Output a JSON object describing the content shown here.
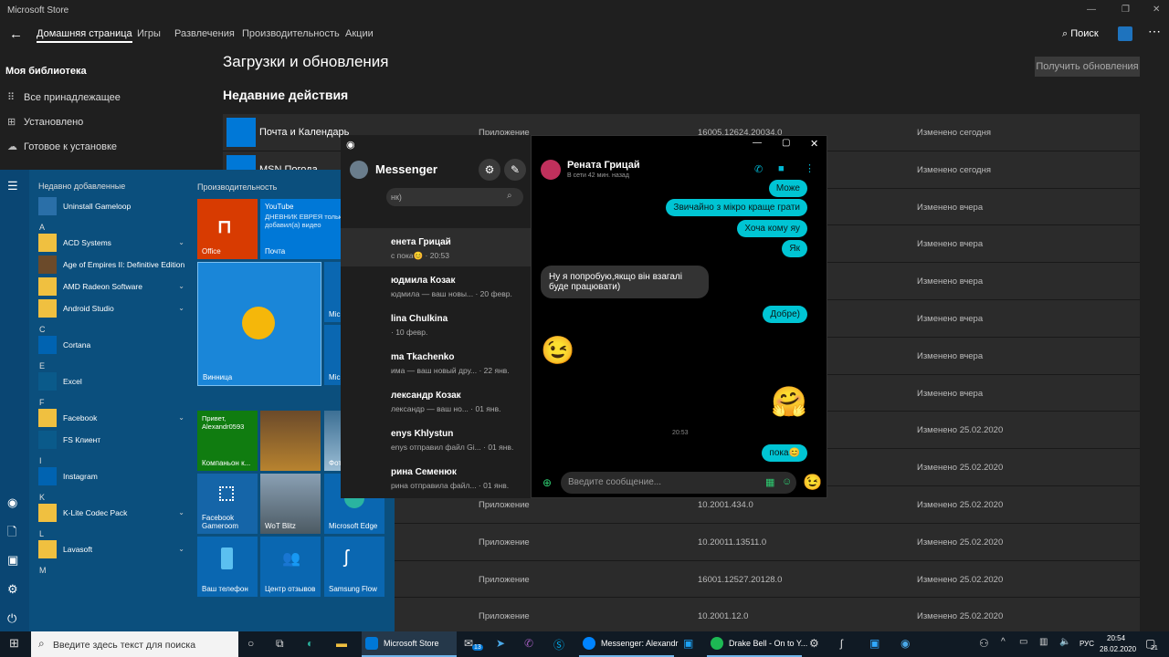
{
  "store": {
    "title": "Microsoft Store",
    "nav": {
      "tabs": [
        "Домашняя страница",
        "Игры",
        "Развлечения",
        "Производительность",
        "Акции"
      ],
      "search_label": "Поиск"
    },
    "library": {
      "heading": "Моя библиотека",
      "items": [
        {
          "icon": "grid-icon",
          "glyph": "⠿",
          "label": "Все принадлежащее"
        },
        {
          "icon": "installed-icon",
          "glyph": "⊞",
          "label": "Установлено"
        },
        {
          "icon": "cloud-icon",
          "glyph": "☁",
          "label": "Готовое к установке"
        }
      ]
    },
    "page_title": "Загрузки и обновления",
    "get_updates_button": "Получить обновления",
    "recent_heading": "Недавние действия",
    "rows": [
      {
        "name": "Почта и Календарь",
        "type": "Приложение",
        "version": "16005.12624.20034.0",
        "status": "Изменено сегодня"
      },
      {
        "name": "MSN Погода",
        "type": "",
        "version": "",
        "status": "Изменено сегодня"
      },
      {
        "name": "",
        "type": "",
        "version": "",
        "status": "Изменено вчера"
      },
      {
        "name": "",
        "type": "",
        "version": "",
        "status": "Изменено вчера"
      },
      {
        "name": "",
        "type": "",
        "version": "",
        "status": "Изменено вчера"
      },
      {
        "name": "",
        "type": "",
        "version": "",
        "status": "Изменено вчера"
      },
      {
        "name": "",
        "type": "",
        "version": "",
        "status": "Изменено вчера"
      },
      {
        "name": "",
        "type": "",
        "version": "",
        "status": "Изменено вчера"
      },
      {
        "name": "",
        "type": "",
        "version": "",
        "status": "Изменено 25.02.2020"
      },
      {
        "name": "",
        "type": "",
        "version": "",
        "status": "Изменено 25.02.2020"
      },
      {
        "name": "",
        "type": "Приложение",
        "version": "10.2001.434.0",
        "status": "Изменено 25.02.2020"
      },
      {
        "name": "",
        "type": "Приложение",
        "version": "10.20011.13511.0",
        "status": "Изменено 25.02.2020"
      },
      {
        "name": "",
        "type": "Приложение",
        "version": "16001.12527.20128.0",
        "status": "Изменено 25.02.2020"
      },
      {
        "name": "",
        "type": "Приложение",
        "version": "10.2001.12.0",
        "status": "Изменено 25.02.2020"
      }
    ]
  },
  "start": {
    "recent_heading": "Недавно добавленные",
    "productivity_heading": "Производительность",
    "apps": [
      {
        "kind": "app",
        "label": "Uninstall Gameloop",
        "color": "#2a6fa8"
      },
      {
        "kind": "letter",
        "label": "A"
      },
      {
        "kind": "app",
        "label": "ACD Systems",
        "color": "#f0c040",
        "chev": "⌄"
      },
      {
        "kind": "app",
        "label": "Age of Empires II: Definitive Edition",
        "color": "#6b4a2a"
      },
      {
        "kind": "app",
        "label": "AMD Radeon Software",
        "color": "#f0c040",
        "chev": "⌄"
      },
      {
        "kind": "app",
        "label": "Android Studio",
        "color": "#f0c040",
        "chev": "⌄"
      },
      {
        "kind": "letter",
        "label": "C"
      },
      {
        "kind": "app",
        "label": "Cortana",
        "color": "#0063b1"
      },
      {
        "kind": "letter",
        "label": "E"
      },
      {
        "kind": "app",
        "label": "Excel",
        "color": "#0a5a8a"
      },
      {
        "kind": "letter",
        "label": "F"
      },
      {
        "kind": "app",
        "label": "Facebook",
        "color": "#f0c040",
        "chev": "⌄"
      },
      {
        "kind": "app",
        "label": "FS Клиент",
        "color": "#0a5a8a"
      },
      {
        "kind": "letter",
        "label": "I"
      },
      {
        "kind": "app",
        "label": "Instagram",
        "color": "#0063b1"
      },
      {
        "kind": "letter",
        "label": "K"
      },
      {
        "kind": "app",
        "label": "K-Lite Codec Pack",
        "color": "#f0c040",
        "chev": "⌄"
      },
      {
        "kind": "letter",
        "label": "L"
      },
      {
        "kind": "app",
        "label": "Lavasoft",
        "color": "#f0c040",
        "chev": "⌄"
      },
      {
        "kind": "letter",
        "label": "M"
      }
    ],
    "tiles": {
      "office": "Office",
      "mail_title": "YouTube",
      "mail_body": "ДНЕВНИК ЕВРЕЯ только что добавил(а) видео",
      "mail_label": "Почта",
      "mail_count": "13",
      "weather": "Винница",
      "ms_office": "Microsoft Office",
      "ms_store": "Microsoft Store",
      "skype_text": "Привет, Alexandr0593",
      "skype_label": "Компаньон к...",
      "photos": "Фотограф...",
      "fb_gameroom": "Facebook Gameroom",
      "wot": "WoT Blitz",
      "edge": "Microsoft Edge",
      "phone": "Ваш телефон",
      "feedback": "Центр отзывов",
      "flow": "Samsung Flow"
    }
  },
  "messenger": {
    "title": "Messenger",
    "search_placeholder": "нк)",
    "conversations": [
      {
        "name": "енета Грицай",
        "preview": "с пока😊 · 20:53"
      },
      {
        "name": "юдмила Козак",
        "preview": "юдмила — ваш новы... · 20 февр."
      },
      {
        "name": "lina Chulkina",
        "preview": "· 10 февр."
      },
      {
        "name": "ma Tkachenko",
        "preview": "има — ваш новый дру... · 22 янв."
      },
      {
        "name": "лександр Козак",
        "preview": "лександр — ваш но... · 01 янв."
      },
      {
        "name": "enys Khlystun",
        "preview": "enys отправил файл Gi... · 01 янв."
      },
      {
        "name": "рина Семенюк",
        "preview": "рина отправила файл... · 01 янв."
      }
    ]
  },
  "chat": {
    "name": "Рената Грицай",
    "status": "В сети 42 мин. назад",
    "messages": [
      {
        "dir": "out",
        "text": "Може"
      },
      {
        "dir": "out",
        "text": "Звичайно з мікро краще грати"
      },
      {
        "dir": "out",
        "text": "Хоча кому яу"
      },
      {
        "dir": "out",
        "text": "Як"
      },
      {
        "dir": "in",
        "text": "Ну я попробую,якщо він взагалі буде працювати)"
      },
      {
        "dir": "out",
        "text": "Добре)"
      }
    ],
    "time": "20:53",
    "last_message": "пока😊",
    "input_placeholder": "Введите сообщение..."
  },
  "taskbar": {
    "search_placeholder": "Введите здесь текст для поиска",
    "apps": [
      "Microsoft Store",
      "Messenger: Alexandr",
      "Drake Bell - On to Y..."
    ],
    "mail_badge": "13",
    "lang": "РУС",
    "time": "20:54",
    "date": "28.02.2020",
    "notif_count": "21"
  }
}
